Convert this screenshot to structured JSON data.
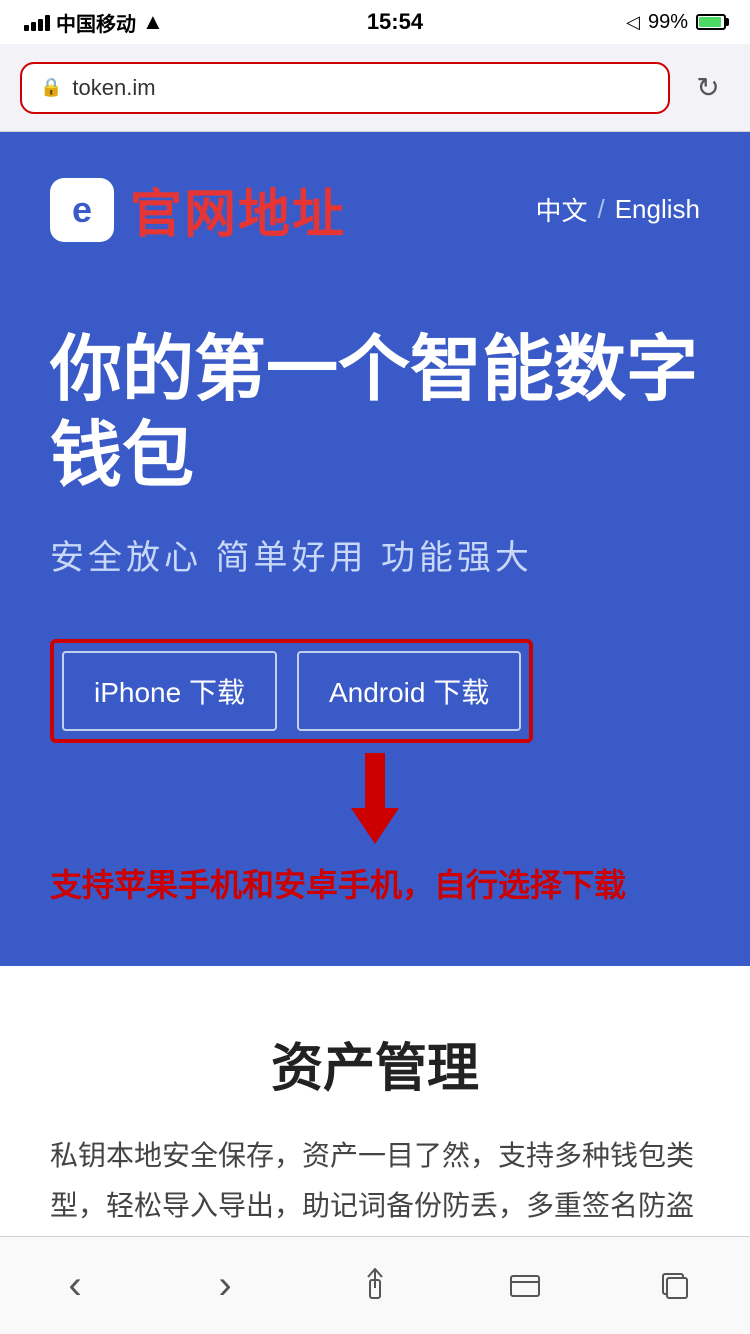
{
  "statusBar": {
    "carrier": "中国移动",
    "time": "15:54",
    "batteryPct": "99%"
  },
  "browserBar": {
    "url": "token.im",
    "refreshLabel": "↻"
  },
  "header": {
    "logoIcon": "e",
    "siteTitle": "官网地址",
    "langZh": "中文",
    "langDivider": "/",
    "langEn": "English"
  },
  "hero": {
    "title": "你的第一个智能数字钱包",
    "subtitle": "安全放心  简单好用  功能强大",
    "iphoneBtn": "iPhone 下载",
    "androidBtn": "Android 下载"
  },
  "annotationText": "支持苹果手机和安卓手机，自行选择下载",
  "whiteSection": {
    "title": "资产管理",
    "body": "私钥本地安全保存，资产一目了然，支持多种钱包类型，轻松导入导出，助记词备份防丢，多重签名防盗"
  },
  "bottomNav": {
    "back": "‹",
    "forward": "›",
    "share": "⬆",
    "bookmarks": "□□",
    "tabs": "⧉"
  }
}
